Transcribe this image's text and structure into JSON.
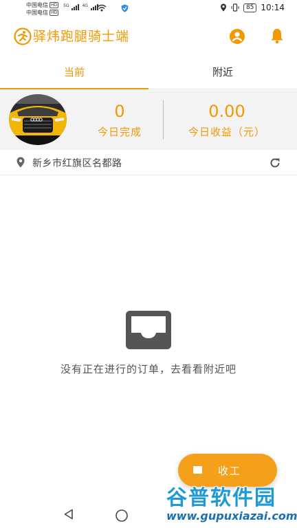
{
  "status_bar": {
    "carrier_1": "中国电信",
    "carrier_2": "中国电信",
    "hd_badge": "HD",
    "net_tag_1": "5G",
    "net_tag_2": "4G",
    "battery": "85",
    "time": "10:14",
    "icons": [
      "signal-icon",
      "wifi-icon",
      "shield-icon",
      "location-icon",
      "vibrate-icon",
      "battery-icon"
    ]
  },
  "header": {
    "title": "驿炜跑腿骑士端",
    "icons": [
      "runner-logo-icon",
      "user-account-icon",
      "bell-icon"
    ],
    "accent_color": "#f39800"
  },
  "tabs": [
    {
      "label": "当前",
      "active": true
    },
    {
      "label": "附近",
      "active": false
    }
  ],
  "stats": {
    "completed_value": "0",
    "completed_label": "今日完成",
    "income_value": "0.00",
    "income_label": "今日收益（元）"
  },
  "location": {
    "address": "新乡市红旗区名都路",
    "icons": [
      "map-pin-icon",
      "refresh-icon"
    ]
  },
  "empty_state": {
    "message": "没有正在进行的订单，去看看附近吧",
    "icon": "inbox-icon"
  },
  "action_button": {
    "label": "收工"
  },
  "watermark": {
    "title": "谷普软件园",
    "url": "www.gupuxiazai.com"
  }
}
